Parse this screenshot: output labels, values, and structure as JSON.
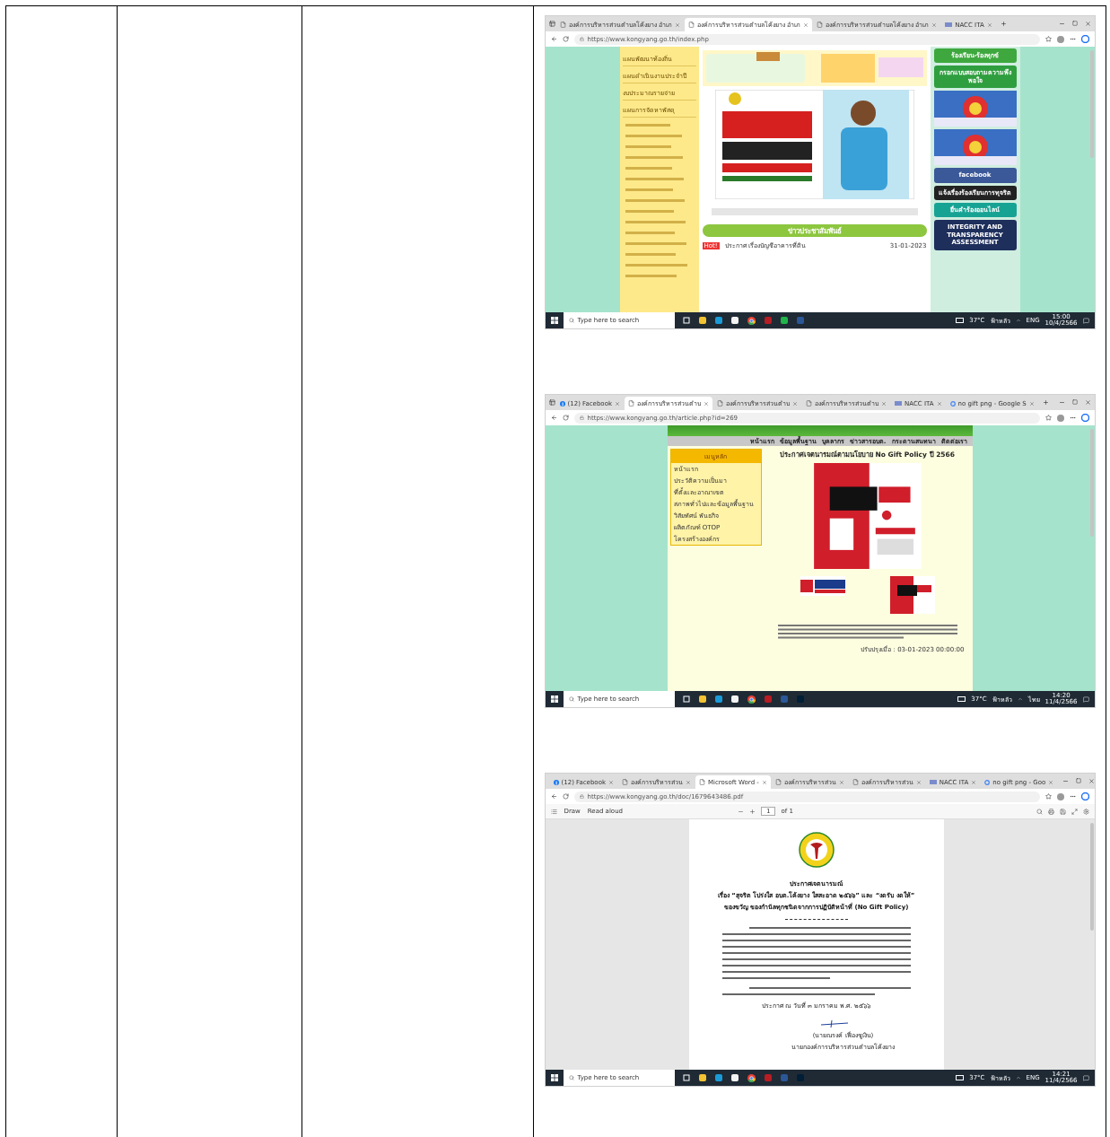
{
  "screenshots": [
    {
      "tabs": [
        {
          "kind": "page",
          "title": "องค์การบริหารส่วนตำบลโค้งยาง อำเภ",
          "selected": false
        },
        {
          "kind": "page",
          "title": "องค์การบริหารส่วนตำบลโค้งยาง อำเภ",
          "selected": true
        },
        {
          "kind": "page",
          "title": "องค์การบริหารส่วนตำบลโค้งยาง อำเภ",
          "selected": false
        },
        {
          "kind": "site",
          "title": "NACC ITA",
          "selected": false
        }
      ],
      "url": "https://www.kongyang.go.th/index.php",
      "page": {
        "kind": "portal",
        "menu": [
          "แผนพัฒนาท้องถิ่น",
          "แผนดำเนินงานประจำปี",
          "งบประมาณรายจ่าย",
          "แผนการจัดหาพัสดุ"
        ],
        "section_title": "ข่าวประชาสัมพันธ์",
        "news": {
          "tag": "Hot!",
          "title": "ประกาศ เรื่องบัญชีอาคารที่ดิน",
          "date": "31-01-2023"
        },
        "banners": [
          {
            "kind": "banner",
            "text": "ร้องเรียน-ร้องทุกข์",
            "color": "#3ea83e"
          },
          {
            "kind": "banner",
            "text": "กรอกแบบสอบถามความพึงพอใจ",
            "color": "#2f9e3f"
          },
          {
            "kind": "picture"
          },
          {
            "kind": "picture"
          },
          {
            "kind": "banner",
            "text": "facebook",
            "color": "#3b5998"
          },
          {
            "kind": "banner",
            "text": "แจ้งเรื่องร้องเรียนการทุจริต",
            "color": "#222222"
          },
          {
            "kind": "banner",
            "text": "ยื่นคำร้องออนไลน์",
            "color": "#17a394"
          },
          {
            "kind": "banner",
            "text": "INTEGRITY AND TRANSPARENCY ASSESSMENT",
            "color": "#1e2f5c"
          }
        ]
      },
      "taskbar": {
        "search": "Type here to search",
        "apps": [
          {
            "kind": "taskview"
          },
          {
            "kind": "folder"
          },
          {
            "kind": "edge"
          },
          {
            "kind": "store"
          },
          {
            "kind": "chrome"
          },
          {
            "kind": "camera"
          },
          {
            "kind": "line"
          },
          {
            "kind": "word"
          }
        ],
        "temperature": "37°C",
        "weather": "ฟ้าหลัว",
        "language": "ENG",
        "time": "15:00",
        "date": "10/4/2566"
      }
    },
    {
      "tabs": [
        {
          "kind": "facebook",
          "title": "(12) Facebook",
          "selected": false
        },
        {
          "kind": "page",
          "title": "องค์การบริหารส่วนตำบ",
          "selected": true
        },
        {
          "kind": "page",
          "title": "องค์การบริหารส่วนตำบ",
          "selected": false
        },
        {
          "kind": "page",
          "title": "องค์การบริหารส่วนตำบ",
          "selected": false
        },
        {
          "kind": "site",
          "title": "NACC ITA",
          "selected": false
        },
        {
          "kind": "google",
          "title": "no gift png - Google S",
          "selected": false
        }
      ],
      "url": "https://www.kongyang.go.th/article.php?id=269",
      "page": {
        "kind": "article",
        "nav": [
          "หน้าแรก",
          "ข้อมูลพื้นฐาน",
          "บุคลากร",
          "ข่าวสารอบต.",
          "กระดานสนทนา",
          "ติดต่อเรา"
        ],
        "heading": "ประกาศเจตนารมณ์ตามนโยบาย No Gift Policy ปี 2566",
        "side_title": "เมนูหลัก",
        "side_menu": [
          "หน้าแรก",
          "ประวัติความเป็นมา",
          "ที่ตั้งและอาณาเขต",
          "สภาพทั่วไปและข้อมูลพื้นฐาน",
          "วิสัยทัศน์ พันธกิจ",
          "ผลิตภัณฑ์ OTOP",
          "โครงสร้างองค์กร"
        ],
        "updated": "ปรับปรุงเมื่อ : 03-01-2023 00:00:00"
      },
      "taskbar": {
        "search": "Type here to search",
        "apps": [
          {
            "kind": "taskview"
          },
          {
            "kind": "folder"
          },
          {
            "kind": "edge"
          },
          {
            "kind": "store"
          },
          {
            "kind": "chrome"
          },
          {
            "kind": "camera"
          },
          {
            "kind": "word"
          },
          {
            "kind": "photoshop"
          }
        ],
        "temperature": "37°C",
        "weather": "ฟ้าหลัว",
        "language": "ไทย",
        "time": "14:20",
        "date": "11/4/2566"
      }
    },
    {
      "tabs": [
        {
          "kind": "facebook",
          "title": "(12) Facebook",
          "selected": false
        },
        {
          "kind": "page",
          "title": "องค์การบริหารส่วน",
          "selected": false
        },
        {
          "kind": "page",
          "title": "Microsoft Word -",
          "selected": true
        },
        {
          "kind": "page",
          "title": "องค์การบริหารส่วน",
          "selected": false
        },
        {
          "kind": "page",
          "title": "องค์การบริหารส่วน",
          "selected": false
        },
        {
          "kind": "site",
          "title": "NACC ITA",
          "selected": false
        },
        {
          "kind": "google",
          "title": "no gift png - Goo",
          "selected": false
        }
      ],
      "url": "https://www.kongyang.go.th/doc/1679643486.pdf",
      "pdf_toolbar": {
        "draw": "Draw",
        "read_aloud": "Read aloud",
        "page": "1",
        "of": "of 1"
      },
      "page": {
        "kind": "pdf",
        "title": "ประกาศเจตนารมณ์",
        "subject": [
          "เรื่อง “สุจริต โปร่งใส อบต.โค้งยาง ใสสะอาด ๒๕๖๖” และ “งดรับ งดให้”",
          "ของขวัญ ของกำนัลทุกชนิดจากการปฏิบัติหน้าที่ (No Gift Policy)"
        ],
        "date_line": "ประกาศ ณ วันที่ ๓ มกราคม พ.ศ. ๒๕๖๖",
        "signer": "(นายณรงค์ เฟื่องชูเงิน)",
        "position": "นายกองค์การบริหารส่วนตำบลโค้งยาง"
      },
      "taskbar": {
        "search": "Type here to search",
        "apps": [
          {
            "kind": "taskview"
          },
          {
            "kind": "folder"
          },
          {
            "kind": "edge"
          },
          {
            "kind": "store"
          },
          {
            "kind": "chrome"
          },
          {
            "kind": "camera"
          },
          {
            "kind": "word"
          },
          {
            "kind": "photoshop"
          }
        ],
        "temperature": "37°C",
        "weather": "ฟ้าหลัว",
        "language": "ENG",
        "time": "14:21",
        "date": "11/4/2566"
      }
    }
  ]
}
